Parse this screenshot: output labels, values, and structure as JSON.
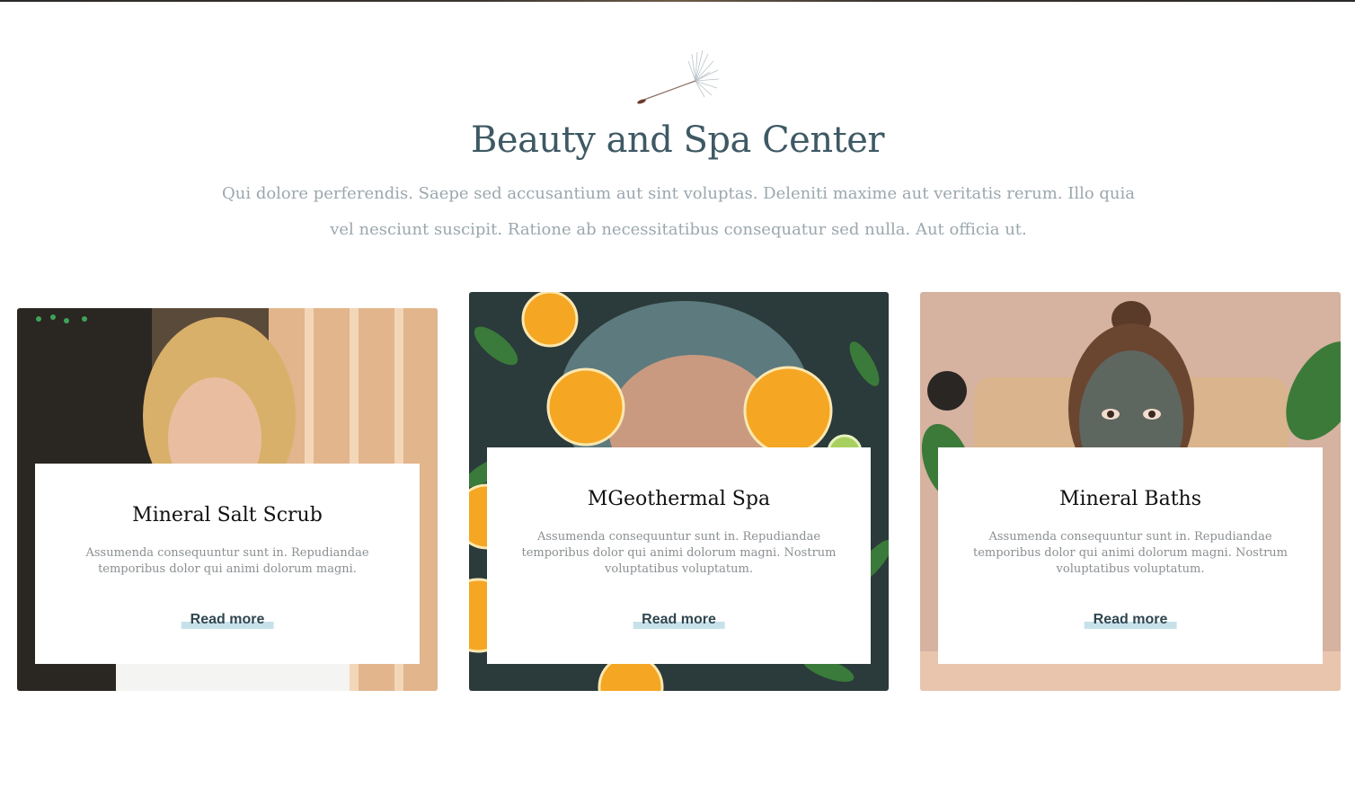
{
  "section": {
    "title": "Beauty and Spa Center",
    "intro": "Qui dolore perferendis. Saepe sed accusantium aut sint voluptas. Deleniti maxime aut veritatis rerum. Illo quia vel nesciunt suscipit. Ratione ab necessitatibus consequatur sed nulla. Aut officia ut.",
    "ornament_icon": "dandelion-seed-icon"
  },
  "cards": [
    {
      "title": "Mineral Salt Scrub",
      "text": "Assumenda consequuntur sunt in. Repudiandae temporibus dolor qui animi dolorum magni.",
      "link": "Read more",
      "image": "woman-blonde-hair-sauna-photo"
    },
    {
      "title": "MGeothermal Spa",
      "text": "Assumenda consequuntur sunt in. Repudiandae temporibus dolor qui animi dolorum magni. Nostrum voluptatibus voluptatum.",
      "link": "Read more",
      "image": "woman-face-water-orange-slices-photo"
    },
    {
      "title": "Mineral Baths",
      "text": "Assumenda consequuntur sunt in. Repudiandae temporibus dolor qui animi dolorum magni. Nostrum voluptatibus voluptatum.",
      "link": "Read more",
      "image": "woman-clay-face-mask-photo"
    }
  ],
  "colors": {
    "heading": "#3e5964",
    "intro_text": "#9ba7ad",
    "link_text": "#2f4650",
    "link_highlight": "#c7e1ea"
  }
}
